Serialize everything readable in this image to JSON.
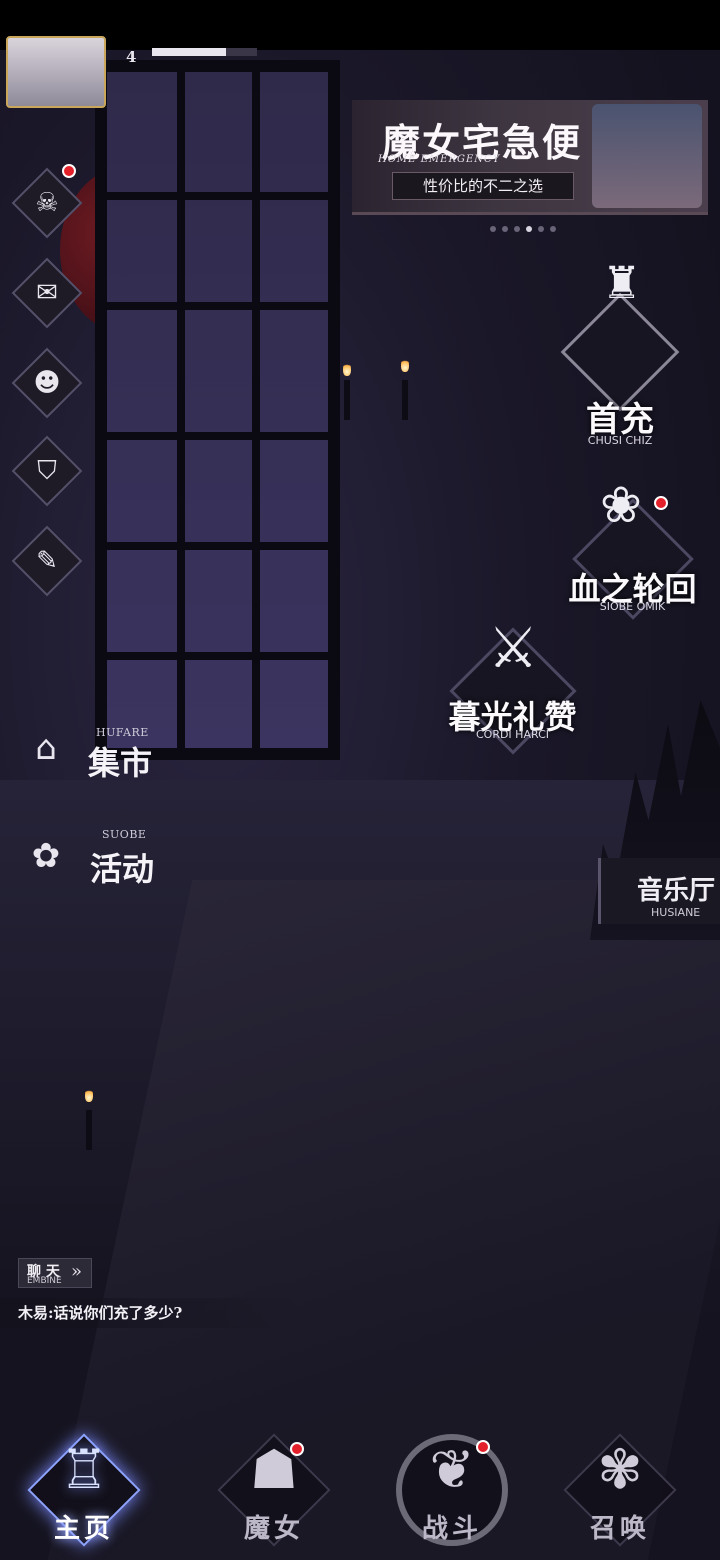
{
  "player": {
    "level": "4",
    "exp_fraction": 0.7
  },
  "banner": {
    "title": "魔女宅急便",
    "subtitle_en": "HOME EMERGENCY",
    "tagline": "性价比的不二之选",
    "page_count": 6,
    "active_page": 4
  },
  "left_menu": [
    {
      "name": "profile",
      "badge": true
    },
    {
      "name": "mail",
      "badge": false
    },
    {
      "name": "friends",
      "badge": false
    },
    {
      "name": "bag",
      "badge": false
    },
    {
      "name": "scroll",
      "badge": false
    }
  ],
  "market": {
    "en": "HUFARE",
    "cn": "集市"
  },
  "activity": {
    "en": "SUOBE",
    "cn": "活动"
  },
  "first_charge": {
    "cn": "首充",
    "en": "CHUSI CHIZ"
  },
  "blood_cycle": {
    "cn": "血之轮回",
    "en": "SIOBE OMIK",
    "badge": true
  },
  "twilight": {
    "cn": "暮光礼赞",
    "en": "CORDI HARCI"
  },
  "music_hall": {
    "cn": "音乐厅",
    "en": "HUSIANE"
  },
  "chat": {
    "label_cn": "聊 天",
    "label_en": "EMBINE",
    "chevron": "»",
    "last_message": "木易:话说你们充了多少?"
  },
  "bottom_nav": [
    {
      "label": "主页",
      "active": true,
      "badge": false
    },
    {
      "label": "魔女",
      "active": false,
      "badge": true
    },
    {
      "label": "战斗",
      "active": false,
      "badge": true
    },
    {
      "label": "召唤",
      "active": false,
      "badge": false
    }
  ],
  "colors": {
    "accent_glow": "#8ea3ff",
    "badge_red": "#e4212b",
    "gold_frame": "#c9a65a"
  }
}
